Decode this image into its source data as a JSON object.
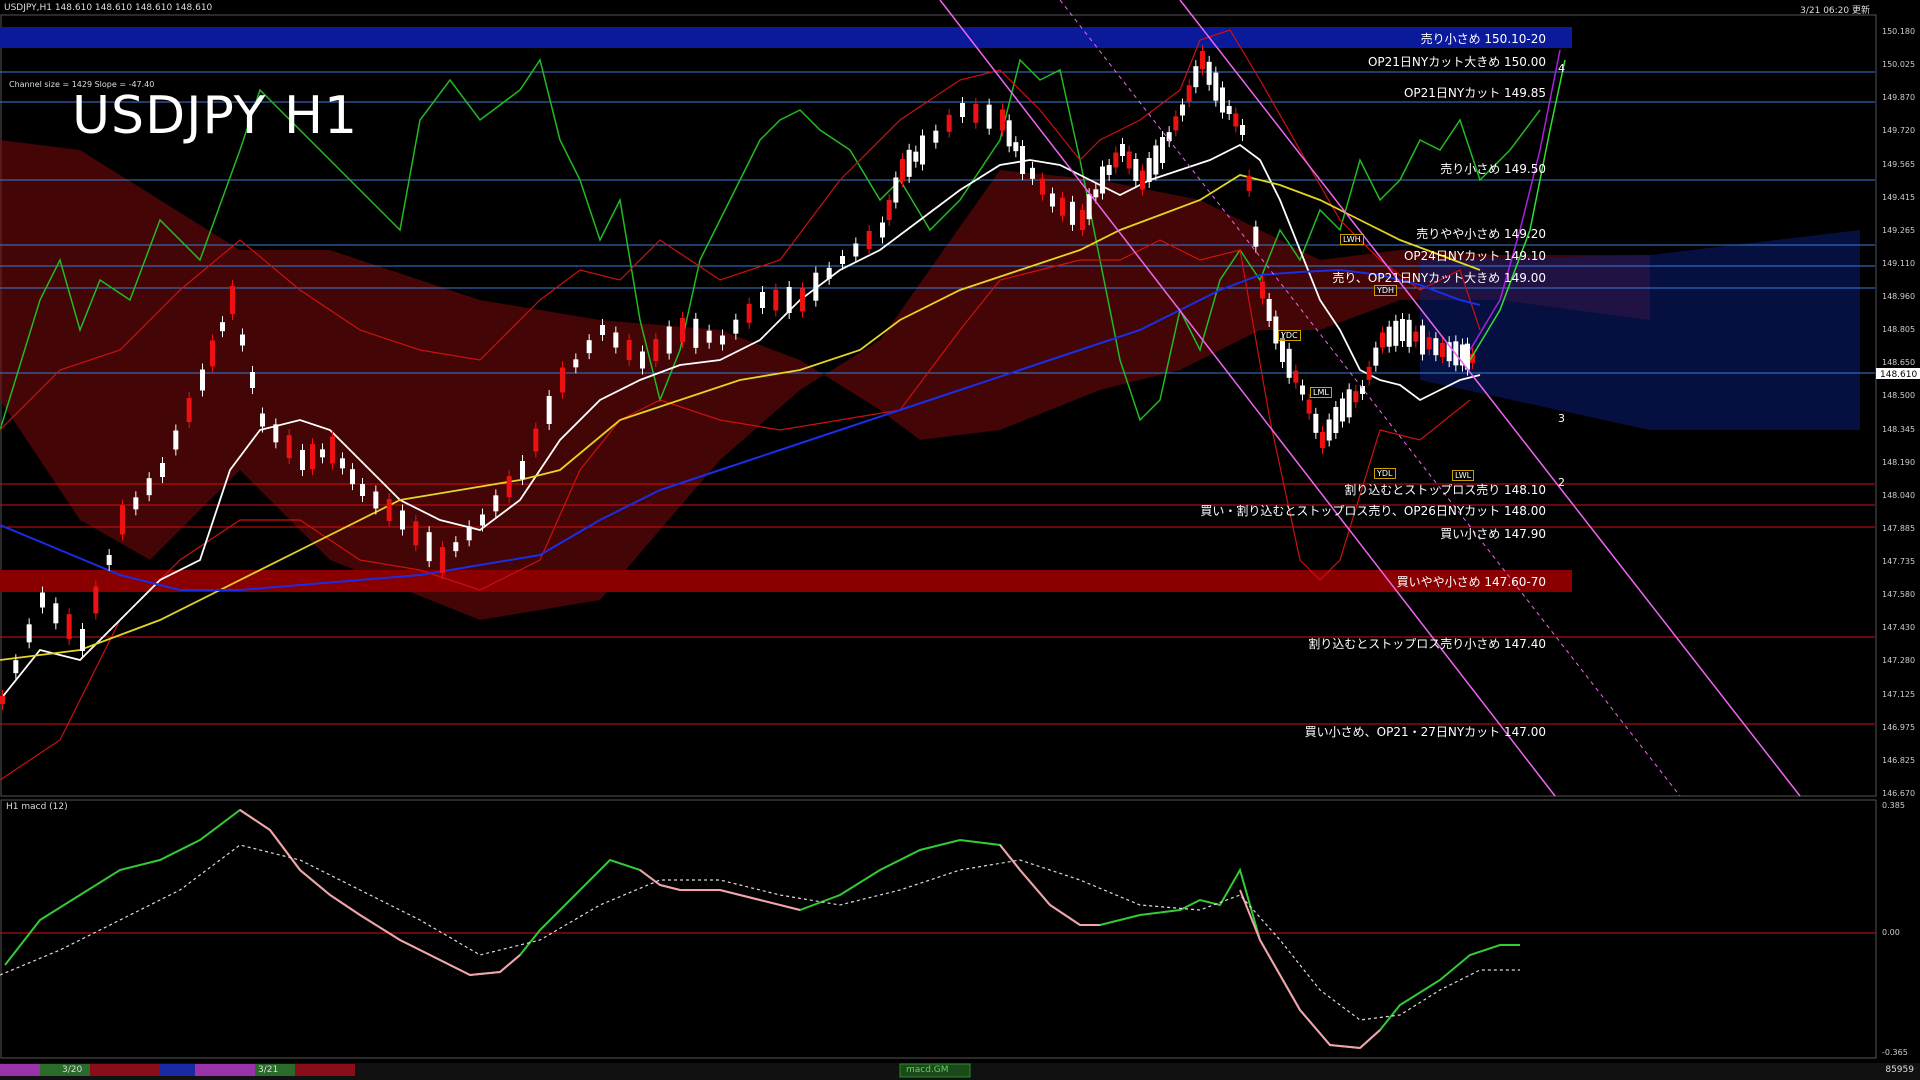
{
  "header": {
    "symbol_line": "USDJPY,H1  148.610 148.610 148.610 148.610",
    "updated": "3/21 06:20 更新"
  },
  "main": {
    "title": "USDJPY H1",
    "channel_info": "Channel size = 1429 Slope = -47.40",
    "price_axis": [
      "150.180",
      "150.025",
      "149.870",
      "149.720",
      "149.565",
      "149.415",
      "149.265",
      "149.110",
      "148.960",
      "148.805",
      "148.650",
      "148.500",
      "148.345",
      "148.190",
      "148.040",
      "147.885",
      "147.735",
      "147.580",
      "147.430",
      "147.280",
      "147.125",
      "146.975",
      "146.825",
      "146.670"
    ],
    "current_price": "148.610",
    "levels": [
      {
        "label": "売り小さめ 150.10-20",
        "kind": "band_blue"
      },
      {
        "label": "OP21日NYカット大きめ 150.00",
        "kind": "line_blue"
      },
      {
        "label": "OP21日NYカット 149.85",
        "kind": "line_blue"
      },
      {
        "label": "売り小さめ 149.50",
        "kind": "line_blue"
      },
      {
        "label": "売りやや小さめ 149.20",
        "kind": "line_blue"
      },
      {
        "label": "OP24日NYカット 149.10",
        "kind": "line_blue"
      },
      {
        "label": "売り、OP21日NYカット大きめ 149.00",
        "kind": "line_blue"
      },
      {
        "label": "割り込むとストップロス売り 148.10",
        "kind": "line_red"
      },
      {
        "label": "買い・割り込むとストップロス売り、OP26日NYカット 148.00",
        "kind": "line_red"
      },
      {
        "label": "買い小さめ 147.90",
        "kind": "line_red"
      },
      {
        "label": "買いやや小さめ 147.60-70",
        "kind": "band_red"
      },
      {
        "label": "割り込むとストップロス売り小さめ 147.40",
        "kind": "line_red"
      },
      {
        "label": "買い小さめ、OP21・27日NYカット 147.00",
        "kind": "line_red"
      }
    ],
    "channel_numbers": [
      "4",
      "3",
      "2"
    ],
    "markers": [
      "LWH",
      "YDH",
      "YDC",
      "LML",
      "YDL",
      "LWL"
    ]
  },
  "macd": {
    "title": "H1 macd (12)",
    "axis": [
      "0.385",
      "0.00",
      "-0.365"
    ]
  },
  "timeline": {
    "dates": [
      "3/20",
      "3/21"
    ],
    "tab": "macd.GM",
    "right_num": "85959"
  },
  "colors": {
    "background": "#000000",
    "level_blue": "#3a7bd5",
    "level_red": "#d01010",
    "band_blue": "#0a1a9a",
    "band_red": "#8a0000",
    "macd_fast": "#33cc33",
    "macd_slow": "#dddddd"
  }
}
